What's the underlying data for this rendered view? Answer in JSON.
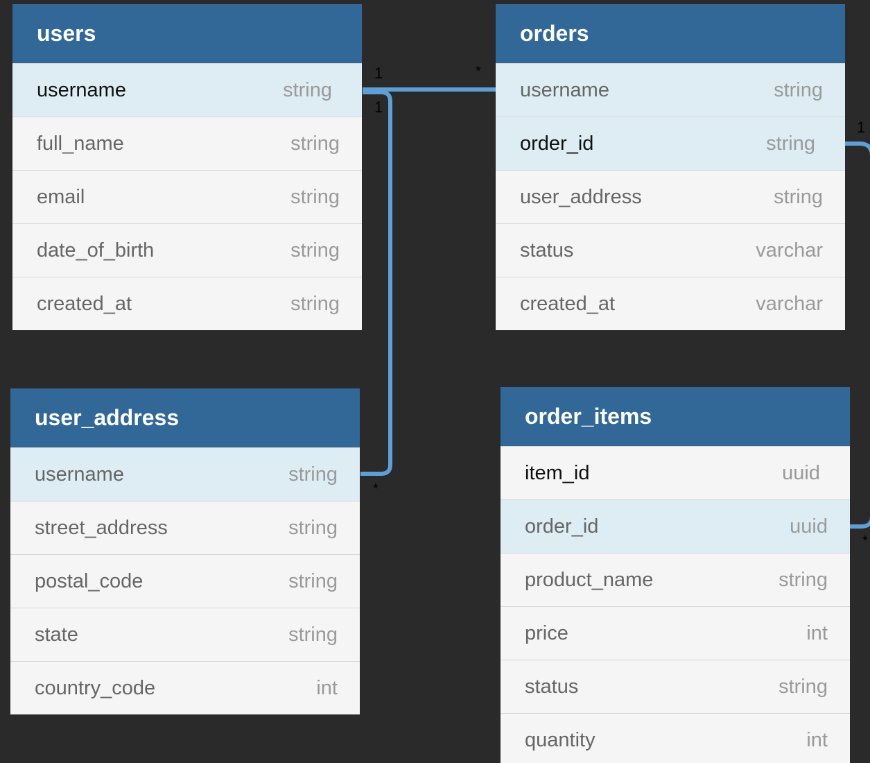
{
  "tables": [
    {
      "id": "users",
      "name": "users",
      "rows": [
        {
          "name": "username",
          "type": "string",
          "highlight": true,
          "dark": true,
          "shift": true
        },
        {
          "name": "full_name",
          "type": "string"
        },
        {
          "name": "email",
          "type": "string"
        },
        {
          "name": "date_of_birth",
          "type": "string"
        },
        {
          "name": "created_at",
          "type": "string"
        }
      ]
    },
    {
      "id": "orders",
      "name": "orders",
      "rows": [
        {
          "name": "username",
          "type": "string",
          "highlight": true
        },
        {
          "name": "order_id",
          "type": "string",
          "highlight": true,
          "dark": true,
          "shift": true
        },
        {
          "name": "user_address",
          "type": "string"
        },
        {
          "name": "status",
          "type": "varchar"
        },
        {
          "name": "created_at",
          "type": "varchar"
        }
      ]
    },
    {
      "id": "user_address",
      "name": "user_address",
      "rows": [
        {
          "name": "username",
          "type": "string",
          "highlight": true
        },
        {
          "name": "street_address",
          "type": "string"
        },
        {
          "name": "postal_code",
          "type": "string"
        },
        {
          "name": "state",
          "type": "string"
        },
        {
          "name": "country_code",
          "type": "int"
        }
      ]
    },
    {
      "id": "order_items",
      "name": "order_items",
      "rows": [
        {
          "name": "item_id",
          "type": "uuid",
          "dark": true,
          "shift": true
        },
        {
          "name": "order_id",
          "type": "uuid",
          "highlight": true
        },
        {
          "name": "product_name",
          "type": "string"
        },
        {
          "name": "price",
          "type": "int"
        },
        {
          "name": "status",
          "type": "string"
        },
        {
          "name": "quantity",
          "type": "int"
        }
      ]
    }
  ],
  "relationships": [
    {
      "from": "users.username",
      "to": "orders.username",
      "from_cardinality": "1",
      "to_cardinality": "*"
    },
    {
      "from": "users.username",
      "to": "user_address.username",
      "from_cardinality": "1",
      "to_cardinality": "*"
    },
    {
      "from": "orders.order_id",
      "to": "order_items.order_id",
      "from_cardinality": "1",
      "to_cardinality": "*"
    }
  ],
  "colors": {
    "background": "#2a2a2a",
    "header": "#326897",
    "row": "#f5f5f5",
    "row_highlight": "#deedf4",
    "connector": "#5f9fd6"
  }
}
